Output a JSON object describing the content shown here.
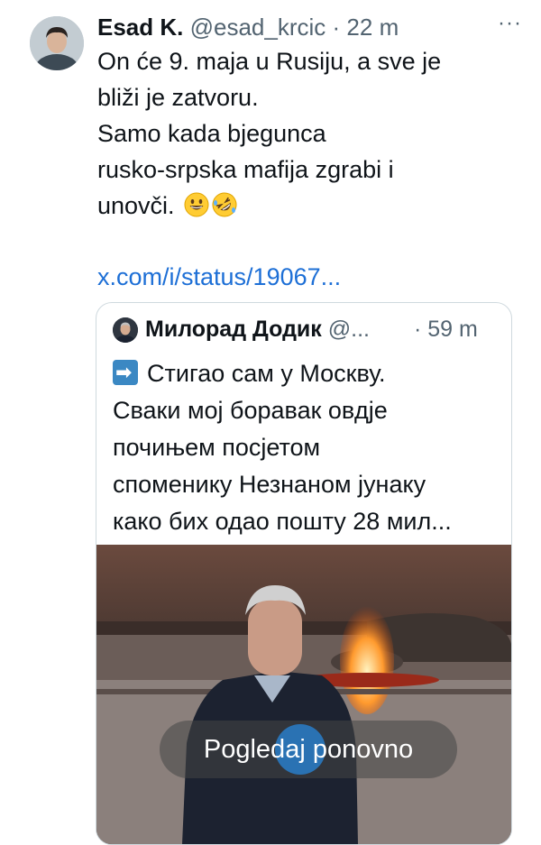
{
  "tweet": {
    "author_name": "Esad K.",
    "author_handle": "@esad_krcic",
    "separator": "·",
    "time": "22 m",
    "more": "···",
    "text_lines": [
      "On će 9. maja u Rusiju, a sve je",
      "bliži je zatvoru.",
      "Samo kada bjegunca",
      "rusko-srpska mafija zgrabi i",
      "unovči."
    ],
    "emojis": [
      "grinning-face-emoji",
      "rolling-on-floor-laughing-emoji"
    ],
    "link": "x.com/i/status/19067..."
  },
  "quote": {
    "author_name": "Милорад Додик",
    "author_handle": "@...",
    "time": "· 59 m",
    "arrow_icon": "right-arrow-icon",
    "text_lines": [
      "Стигао сам у Москву.",
      "Сваки мој боравак овдје",
      "почињем посјетом",
      "споменику Незнаном јунаку",
      "како бих одао пошту 28 мил..."
    ],
    "video": {
      "replay_label": "Pogledaj ponovno",
      "replay_icon": "replay-icon"
    }
  },
  "colors": {
    "text": "#0f1419",
    "secondary": "#536471",
    "link": "#1d6fd6",
    "border": "#cfd9de"
  }
}
